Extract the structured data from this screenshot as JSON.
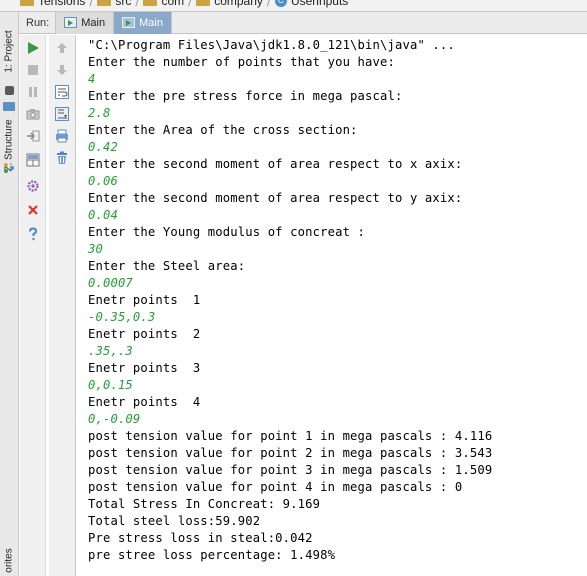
{
  "breadcrumb": {
    "items": [
      "Tensions",
      "src",
      "com",
      "company",
      "Userinputs"
    ]
  },
  "left_stripe": {
    "project_tab": "1: Project",
    "structure_tab": "Z: Structure",
    "favorites_tab": "orites"
  },
  "run_panel": {
    "label": "Run:",
    "tabs": [
      {
        "label": "Main",
        "active": false
      },
      {
        "label": "Main",
        "active": true
      }
    ]
  },
  "console": {
    "lines": [
      {
        "kind": "cmd",
        "text": "\"C:\\Program Files\\Java\\jdk1.8.0_121\\bin\\java\" ..."
      },
      {
        "kind": "out",
        "text": "Enter the number of points that you have:"
      },
      {
        "kind": "in",
        "text": "4"
      },
      {
        "kind": "out",
        "text": "Enter the pre stress force in mega pascal:"
      },
      {
        "kind": "in",
        "text": "2.8"
      },
      {
        "kind": "out",
        "text": "Enter the Area of the cross section:"
      },
      {
        "kind": "in",
        "text": "0.42"
      },
      {
        "kind": "out",
        "text": "Enter the second moment of area respect to x axix:"
      },
      {
        "kind": "in",
        "text": "0.06"
      },
      {
        "kind": "out",
        "text": "Enter the second moment of area respect to y axix:"
      },
      {
        "kind": "in",
        "text": "0.04"
      },
      {
        "kind": "out",
        "text": "Enter the Young modulus of concreat :"
      },
      {
        "kind": "in",
        "text": "30"
      },
      {
        "kind": "out",
        "text": "Enter the Steel area:"
      },
      {
        "kind": "in",
        "text": "0.0007"
      },
      {
        "kind": "out",
        "text": "Enetr points  1"
      },
      {
        "kind": "in",
        "text": "-0.35,0.3"
      },
      {
        "kind": "out",
        "text": "Enetr points  2"
      },
      {
        "kind": "in",
        "text": ".35,.3"
      },
      {
        "kind": "out",
        "text": "Enetr points  3"
      },
      {
        "kind": "in",
        "text": "0,0.15"
      },
      {
        "kind": "out",
        "text": "Enetr points  4"
      },
      {
        "kind": "in",
        "text": "0,-0.09"
      },
      {
        "kind": "out",
        "text": "post tension value for point 1 in mega pascals : 4.116"
      },
      {
        "kind": "out",
        "text": "post tension value for point 2 in mega pascals : 3.543"
      },
      {
        "kind": "out",
        "text": "post tension value for point 3 in mega pascals : 1.509"
      },
      {
        "kind": "out",
        "text": "post tension value for point 4 in mega pascals : 0"
      },
      {
        "kind": "out",
        "text": "Total Stress In Concreat: 9.169"
      },
      {
        "kind": "out",
        "text": "Total steel loss:59.902"
      },
      {
        "kind": "out",
        "text": "Pre stress loss in steal:0.042"
      },
      {
        "kind": "out",
        "text": "pre stree loss percentage: 1.498%"
      }
    ]
  },
  "colors": {
    "user_input": "#23a034",
    "active_tab": "#8aa8c8",
    "run_green": "#3a9a3a",
    "stop_red": "#d9362b"
  },
  "icons": {
    "col1": [
      "rerun-icon",
      "stop-icon",
      "pause-icon",
      "dump-threads-icon",
      "restore-layout-icon",
      "settings-icon",
      "pin-icon",
      "close-icon",
      "help-icon"
    ],
    "col2": [
      "up-arrow-icon",
      "down-arrow-icon",
      "soft-wrap-icon",
      "scroll-to-end-icon",
      "print-icon",
      "clear-icon"
    ]
  }
}
